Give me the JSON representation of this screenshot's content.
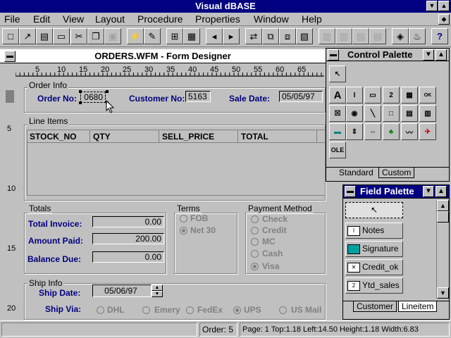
{
  "app": {
    "title": "Visual dBASE"
  },
  "menu": [
    "File",
    "Edit",
    "View",
    "Layout",
    "Procedure",
    "Properties",
    "Window",
    "Help"
  ],
  "document": {
    "title": "ORDERS.WFM - Form Designer"
  },
  "ruler": {
    "h_ticks": [
      "5",
      "10",
      "15",
      "20",
      "25",
      "30",
      "35",
      "40",
      "45",
      "50",
      "55",
      "60",
      "65"
    ],
    "v_ticks": [
      "5",
      "10",
      "15",
      "20"
    ]
  },
  "form": {
    "order_info": {
      "label": "Order Info",
      "order_no_label": "Order No:",
      "order_no_value": "0680",
      "customer_no_label": "Customer No:",
      "customer_no_value": "5163",
      "sale_date_label": "Sale Date:",
      "sale_date_value": "05/05/97"
    },
    "line_items": {
      "label": "Line Items",
      "columns": [
        "STOCK_NO",
        "QTY",
        "SELL_PRICE",
        "TOTAL"
      ]
    },
    "totals": {
      "label": "Totals",
      "total_invoice_label": "Total Invoice:",
      "total_invoice_value": "0.00",
      "amount_paid_label": "Amount Paid:",
      "amount_paid_value": "200.00",
      "balance_due_label": "Balance Due:",
      "balance_due_value": "0.00"
    },
    "terms": {
      "label": "Terms",
      "options": [
        "FOB",
        "Net 30"
      ],
      "selected": "Net 30"
    },
    "payment": {
      "label": "Payment Method",
      "options": [
        "Check",
        "Credit",
        "MC",
        "Cash",
        "Visa"
      ],
      "selected": "Visa"
    },
    "ship_info": {
      "label": "Ship Info",
      "ship_date_label": "Ship Date:",
      "ship_date_value": "05/06/97",
      "ship_via_label": "Ship Via:",
      "ship_via_options": [
        "DHL",
        "Emery",
        "FedEx",
        "UPS",
        "US Mail"
      ],
      "ship_via_selected": "UPS"
    }
  },
  "control_palette": {
    "title": "Control Palette",
    "tabs": [
      "Standard",
      "Custom"
    ],
    "ole_label": "OLE"
  },
  "field_palette": {
    "title": "Field Palette",
    "fields": [
      "Notes",
      "Signature",
      "Credit_ok",
      "Ytd_sales"
    ],
    "tabs": [
      "Customer",
      "Lineitem"
    ]
  },
  "status": {
    "order": "Order: 5",
    "position": "Page: 1 Top:1.18 Left:14.50 Height:1.18 Width:6.83"
  },
  "colors": {
    "title_bg": "#000080",
    "label": "#000080",
    "face": "#c0c0c0"
  }
}
